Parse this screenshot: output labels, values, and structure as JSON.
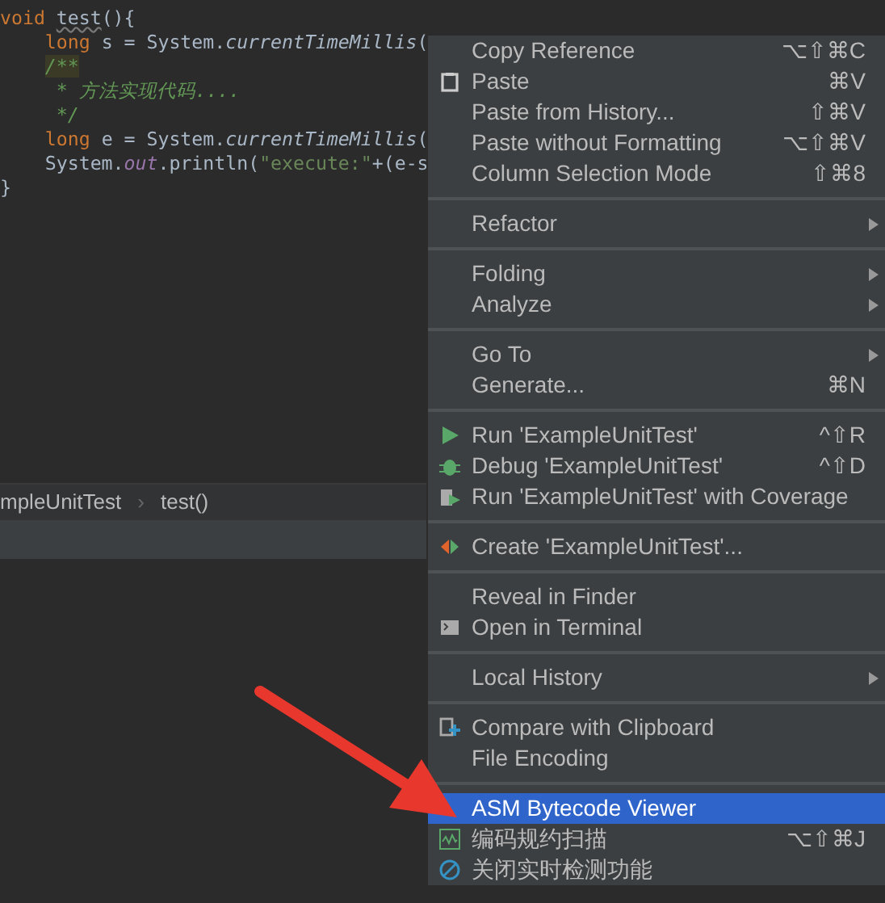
{
  "editor": {
    "lines": [
      {
        "kind": "top",
        "tokens": [
          {
            "text": "void ",
            "kind": "keyword"
          },
          {
            "text": "test",
            "kind": "unused"
          },
          {
            "text": "(){",
            "kind": "plain"
          }
        ]
      },
      {
        "kind": "body",
        "tokens": [
          {
            "text": "long ",
            "kind": "keyword"
          },
          {
            "text": "s = System.",
            "kind": "plain"
          },
          {
            "text": "currentTimeMillis",
            "kind": "static"
          },
          {
            "text": "(",
            "kind": "plain"
          }
        ]
      },
      {
        "kind": "body",
        "tokens": [
          {
            "text": "/**",
            "kind": "doc-highlight"
          }
        ]
      },
      {
        "kind": "doc",
        "tokens": [
          {
            "text": "* 方法实现代码....",
            "kind": "doc"
          }
        ]
      },
      {
        "kind": "doc",
        "tokens": [
          {
            "text": "*/",
            "kind": "doc"
          }
        ]
      },
      {
        "kind": "body",
        "tokens": [
          {
            "text": "long ",
            "kind": "keyword"
          },
          {
            "text": "e = System.",
            "kind": "plain"
          },
          {
            "text": "currentTimeMillis",
            "kind": "static"
          },
          {
            "text": "(",
            "kind": "plain"
          }
        ]
      },
      {
        "kind": "body",
        "tokens": [
          {
            "text": "System.",
            "kind": "plain"
          },
          {
            "text": "out",
            "kind": "field"
          },
          {
            "text": ".println(",
            "kind": "plain"
          },
          {
            "text": "\"execute:\"",
            "kind": "string"
          },
          {
            "text": "+(e-s",
            "kind": "plain"
          }
        ]
      },
      {
        "kind": "top",
        "tokens": [
          {
            "text": "}",
            "kind": "plain"
          }
        ]
      }
    ]
  },
  "breadcrumbs": [
    "mpleUnitTest",
    "test()"
  ],
  "breadcrumb_separator": "›",
  "context_menu": [
    {
      "kind": "item",
      "label": "Copy Reference",
      "shortcut": "⌥⇧⌘C",
      "submenu": false,
      "selected": false
    },
    {
      "kind": "item",
      "label": "Paste",
      "shortcut": "⌘V",
      "submenu": false,
      "selected": false
    },
    {
      "kind": "item",
      "label": "Paste from History...",
      "shortcut": "⇧⌘V",
      "submenu": false,
      "selected": false
    },
    {
      "kind": "item",
      "label": "Paste without Formatting",
      "shortcut": "⌥⇧⌘V",
      "submenu": false,
      "selected": false
    },
    {
      "kind": "item",
      "label": "Column Selection Mode",
      "shortcut": "⇧⌘8",
      "submenu": false,
      "selected": false
    },
    {
      "kind": "separator"
    },
    {
      "kind": "item",
      "label": "Refactor",
      "submenu": true,
      "selected": false
    },
    {
      "kind": "separator"
    },
    {
      "kind": "item",
      "label": "Folding",
      "submenu": true,
      "selected": false
    },
    {
      "kind": "item",
      "label": "Analyze",
      "submenu": true,
      "selected": false
    },
    {
      "kind": "separator"
    },
    {
      "kind": "item",
      "label": "Go To",
      "submenu": true,
      "selected": false
    },
    {
      "kind": "item",
      "label": "Generate...",
      "shortcut": "⌘N",
      "submenu": false,
      "selected": false
    },
    {
      "kind": "separator"
    },
    {
      "kind": "item",
      "label": "Run 'ExampleUnitTest'",
      "shortcut": "^⇧R",
      "submenu": false,
      "selected": false
    },
    {
      "kind": "item",
      "label": "Debug 'ExampleUnitTest'",
      "shortcut": "^⇧D",
      "submenu": false,
      "selected": false
    },
    {
      "kind": "item",
      "label": "Run 'ExampleUnitTest' with Coverage",
      "submenu": false,
      "selected": false
    },
    {
      "kind": "separator"
    },
    {
      "kind": "item",
      "label": "Create 'ExampleUnitTest'...",
      "submenu": false,
      "selected": false
    },
    {
      "kind": "separator"
    },
    {
      "kind": "item",
      "label": "Reveal in Finder",
      "submenu": false,
      "selected": false
    },
    {
      "kind": "item",
      "label": "Open in Terminal",
      "submenu": false,
      "selected": false
    },
    {
      "kind": "separator"
    },
    {
      "kind": "item",
      "label": "Local History",
      "submenu": true,
      "selected": false
    },
    {
      "kind": "separator"
    },
    {
      "kind": "item",
      "label": "Compare with Clipboard",
      "submenu": false,
      "selected": false
    },
    {
      "kind": "item",
      "label": "File Encoding",
      "submenu": false,
      "selected": false
    },
    {
      "kind": "separator"
    },
    {
      "kind": "item",
      "label": "ASM Bytecode Viewer",
      "submenu": false,
      "selected": true
    },
    {
      "kind": "item",
      "label": "编码规约扫描",
      "shortcut": "⌥⇧⌘J",
      "submenu": false,
      "selected": false
    },
    {
      "kind": "item",
      "label": "关闭实时检测功能",
      "submenu": false,
      "selected": false
    }
  ]
}
